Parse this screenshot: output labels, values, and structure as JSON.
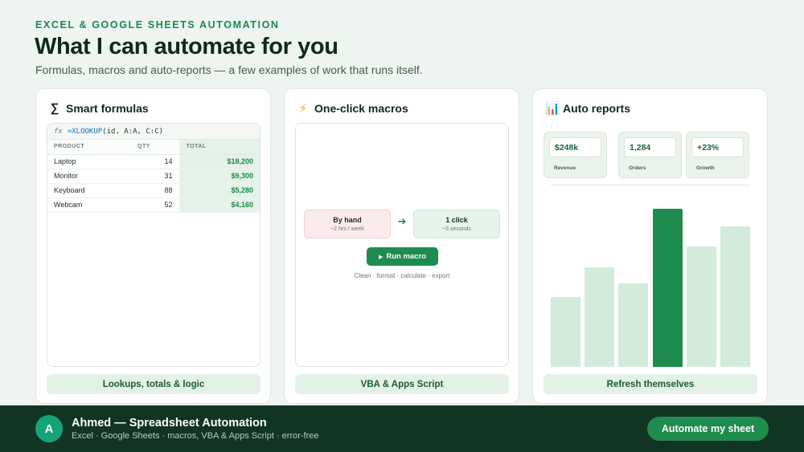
{
  "header": {
    "eyebrow": "EXCEL & GOOGLE SHEETS AUTOMATION",
    "title": "What I can automate for you",
    "subtitle": "Formulas, macros and auto-reports — a few examples of work that runs itself."
  },
  "cards": {
    "formulas": {
      "icon": "∑",
      "title": "Smart formulas",
      "formula_prefix": "fx",
      "formula_fn": "=XLOOKUP",
      "formula_args": "(id, A:A, C:C)",
      "columns": [
        "PRODUCT",
        "QTY",
        "TOTAL"
      ],
      "rows": [
        {
          "product": "Laptop",
          "qty": "14",
          "total": "$18,200"
        },
        {
          "product": "Monitor",
          "qty": "31",
          "total": "$9,300"
        },
        {
          "product": "Keyboard",
          "qty": "88",
          "total": "$5,280"
        },
        {
          "product": "Webcam",
          "qty": "52",
          "total": "$4,160"
        }
      ],
      "footer": "Lookups, totals & logic"
    },
    "macros": {
      "icon": "⚡",
      "title": "One-click macros",
      "by_hand_title": "By hand",
      "by_hand_sub": "~2 hrs / week",
      "arrow": "➔",
      "click_title": "1 click",
      "click_sub": "~3 seconds",
      "run_icon": "▶",
      "run_label": "Run macro",
      "steps": "Clean · format · calculate · export",
      "footer": "VBA & Apps Script"
    },
    "reports": {
      "icon": "📊",
      "title": "Auto reports",
      "kpis": [
        {
          "value": "$248k",
          "label": "Revenue"
        },
        {
          "value": "1,284",
          "label": "Orders"
        },
        {
          "value": "+23%",
          "label": "Growth"
        }
      ],
      "bar_levels": [
        0.44,
        0.63,
        0.53,
        1.0,
        0.76,
        0.89
      ],
      "highlight_index": 3,
      "footer": "Refresh themselves"
    }
  },
  "footer": {
    "avatar_initial": "A",
    "name": "Ahmed — Spreadsheet Automation",
    "tagline": "Excel · Google Sheets · macros, VBA & Apps Script · error-free",
    "cta": "Automate my sheet"
  },
  "colors": {
    "accent": "#1e8c4f",
    "footer_bg": "#123423",
    "avatar": "#16a37a",
    "page_bg": "#eef4ef"
  }
}
